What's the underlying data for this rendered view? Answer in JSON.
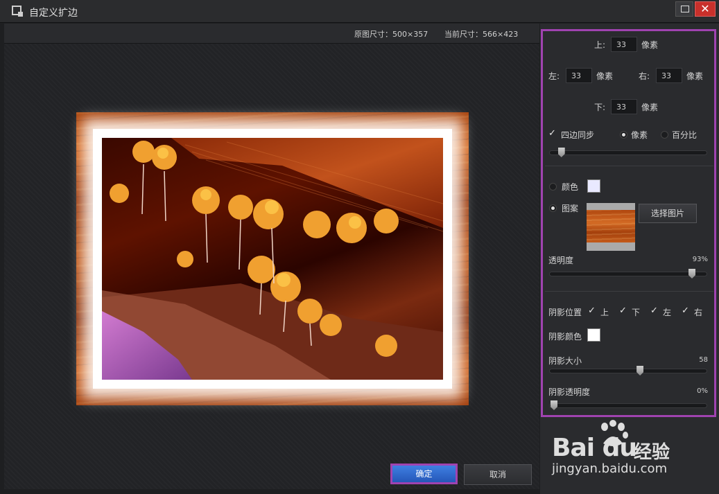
{
  "window": {
    "title": "自定义扩边"
  },
  "info": {
    "original_size": "原图尺寸：500×357",
    "current_size": "当前尺寸：566×423"
  },
  "margins": {
    "top_label": "上:",
    "left_label": "左:",
    "right_label": "右:",
    "bottom_label": "下:",
    "unit": "像素",
    "top": "33",
    "left": "33",
    "right": "33",
    "bottom": "33",
    "sync_label": "四边同步",
    "sync_checked": true,
    "unit_pixel": "像素",
    "unit_percent": "百分比",
    "selected_unit": "pixel",
    "slider_fraction": 0.05
  },
  "fill": {
    "color_label": "颜色",
    "color_value": "#e9e9ff",
    "pattern_label": "图案",
    "selected": "pattern",
    "select_image_label": "选择图片",
    "opacity_label": "透明度",
    "opacity_value": "93%",
    "opacity_fraction": 0.93
  },
  "shadow": {
    "position_label": "阴影位置",
    "positions": [
      {
        "label": "上",
        "checked": true
      },
      {
        "label": "下",
        "checked": true
      },
      {
        "label": "左",
        "checked": true
      },
      {
        "label": "右",
        "checked": true
      }
    ],
    "color_label": "阴影颜色",
    "color_value": "#ffffff",
    "size_label": "阴影大小",
    "size_value": "58",
    "size_fraction": 0.58,
    "opacity_label": "阴影透明度",
    "opacity_value": "0%",
    "opacity_fraction": 0.0
  },
  "buttons": {
    "ok": "确定",
    "cancel": "取消"
  },
  "watermark": {
    "logo": "Bai du",
    "brand_cn": "经验",
    "url": "jingyan.baidu.com"
  }
}
